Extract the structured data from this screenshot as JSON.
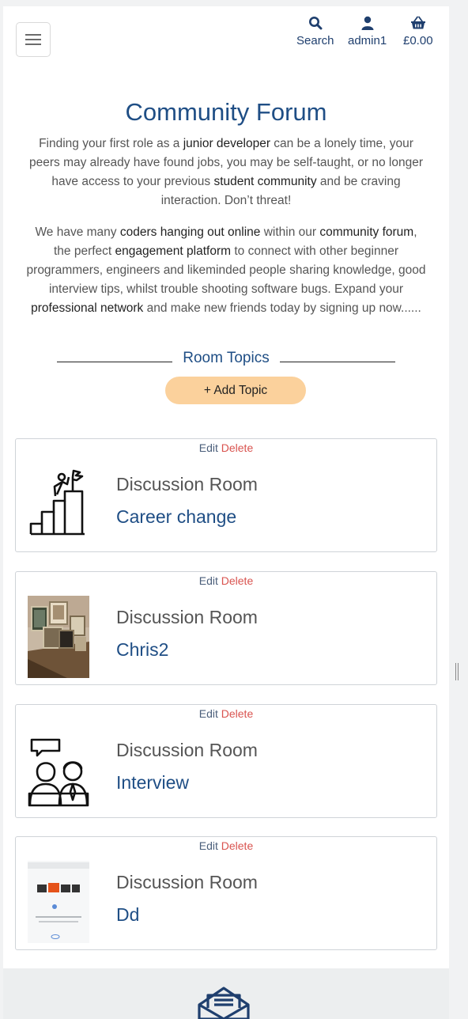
{
  "header": {
    "menu_icon": "hamburger-icon",
    "search_label": "Search",
    "account_label": "admin1",
    "basket_label": "£0.00",
    "icons": {
      "search": "search-icon",
      "account": "user-icon",
      "basket": "basket-icon"
    },
    "accent_color": "#1f4e85"
  },
  "intro": {
    "title": "Community Forum",
    "p1": {
      "t1": "Finding your first role as a ",
      "b1": "junior developer",
      "t2": " can be a lonely time, your peers may already have found jobs, you may be self-taught, or no longer have access to your previous ",
      "b2": "student community",
      "t3": " and be craving interaction. Don’t threat!"
    },
    "p2": {
      "t1": "We have many ",
      "b1": "coders hanging out online",
      "t2": " within our ",
      "b2": "community forum",
      "t3": ", the perfect ",
      "b3": "engagement platform",
      "t4": " to connect with other beginner programmers, engineers and likeminded people sharing knowledge, good interview tips, whilst trouble shooting software bugs. Expand your ",
      "b4": "professional network",
      "t5": " and make new friends today by signing up now......"
    }
  },
  "topics": {
    "heading": "Room Topics",
    "add_label": "+ Add Topic",
    "add_color": "#fbd19c"
  },
  "rooms": [
    {
      "edit": "Edit",
      "delete": "Delete",
      "heading": "Discussion Room",
      "name": "Career change",
      "image": "career-ladder-icon"
    },
    {
      "edit": "Edit",
      "delete": "Delete",
      "heading": "Discussion Room",
      "name": "Chris2",
      "image": "photo-frames-image"
    },
    {
      "edit": "Edit",
      "delete": "Delete",
      "heading": "Discussion Room",
      "name": "Interview",
      "image": "interview-people-icon"
    },
    {
      "edit": "Edit",
      "delete": "Delete",
      "heading": "Discussion Room",
      "name": "Dd",
      "image": "screenshot-thumbnail-image"
    }
  ],
  "footer": {
    "icon": "envelope-icon"
  }
}
